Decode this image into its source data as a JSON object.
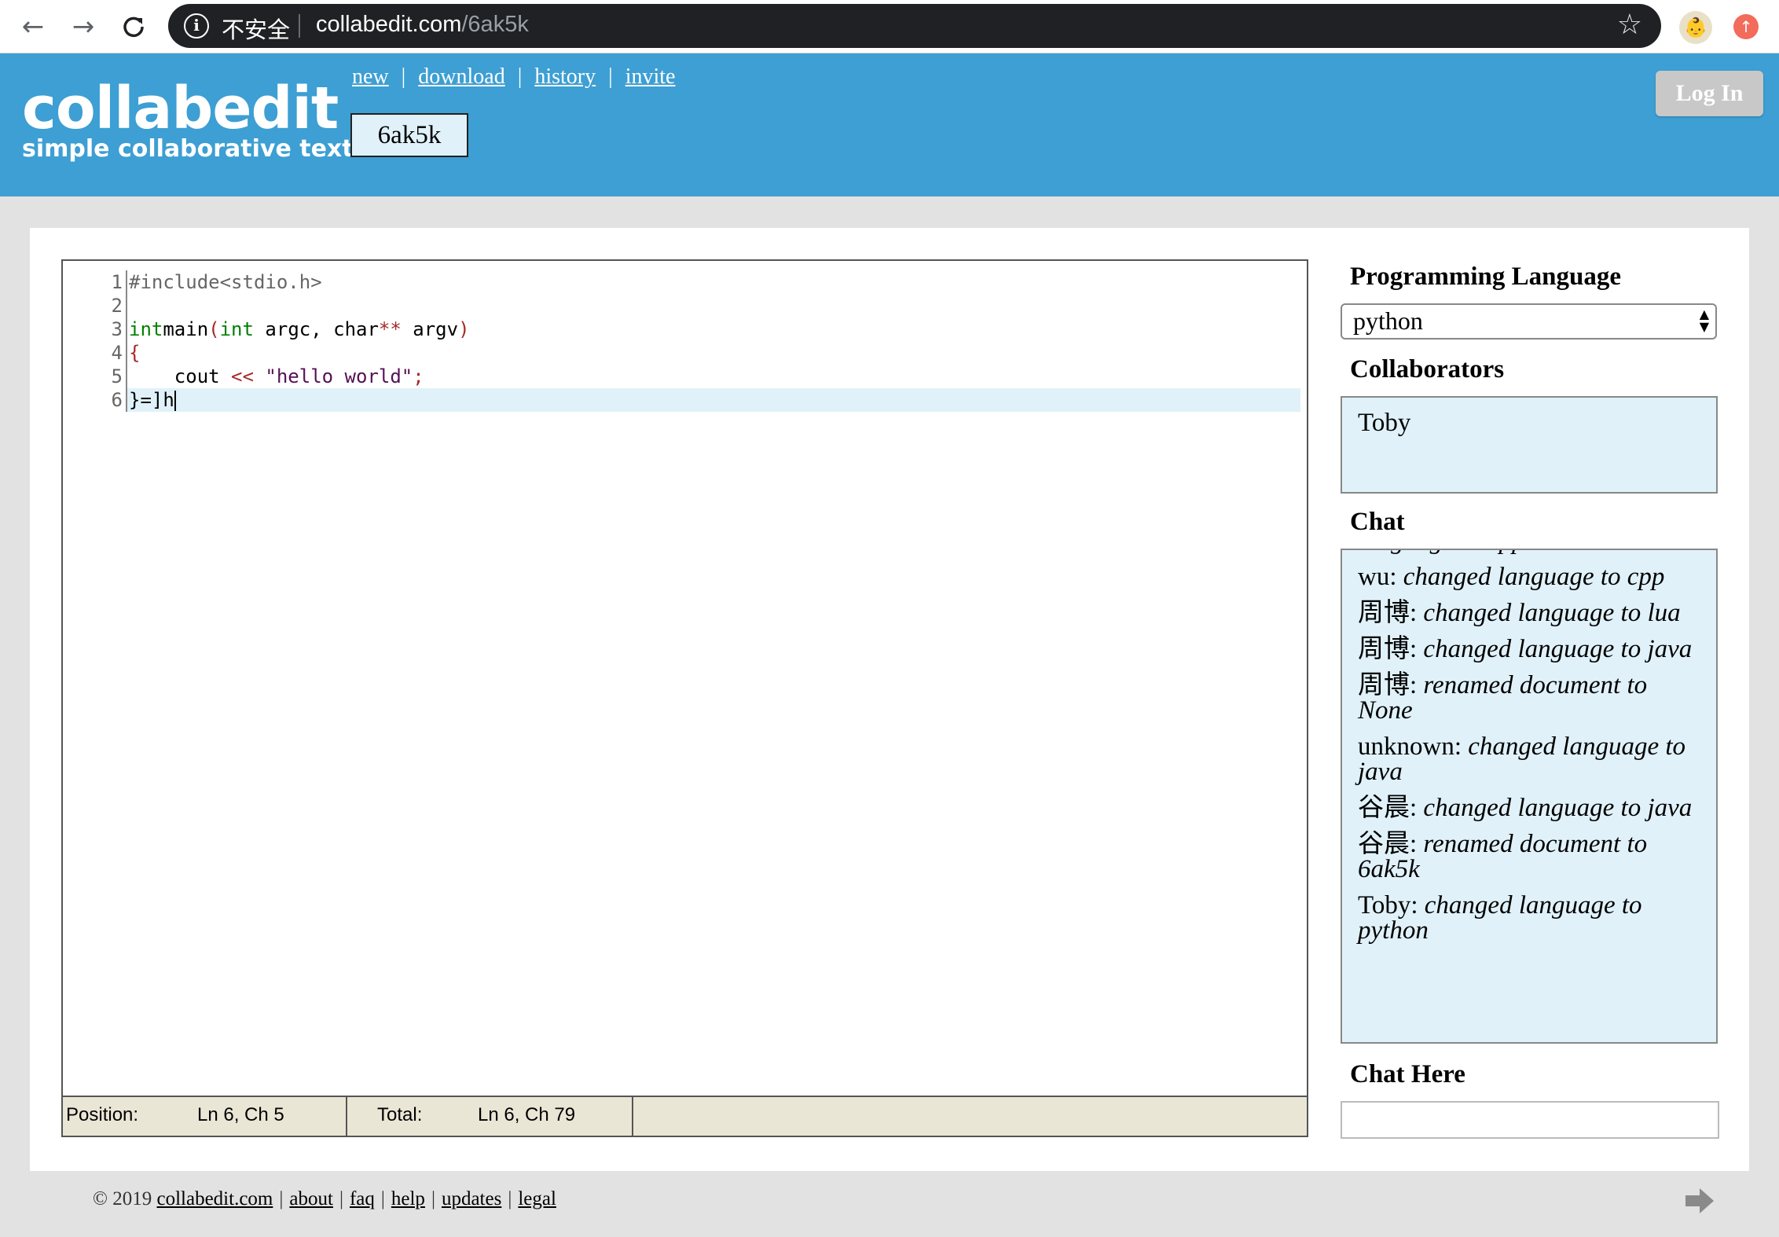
{
  "browser": {
    "security_label": "不安全",
    "url_host": "collabedit.com",
    "url_path": "/6ak5k"
  },
  "header": {
    "logo_title": "collabedit",
    "logo_tagline": "simple collaborative text",
    "nav": [
      "new",
      "download",
      "history",
      "invite"
    ],
    "doc_name": "6ak5k",
    "login_label": "Log In"
  },
  "editor": {
    "line_numbers": [
      "1",
      "2",
      "3",
      "4",
      "5",
      "6"
    ],
    "status": {
      "position_label": "Position:",
      "position_value": "Ln 6, Ch 5",
      "total_label": "Total:",
      "total_value": "Ln 6, Ch 79"
    }
  },
  "sidebar": {
    "language_title": "Programming Language",
    "language_value": "python",
    "collaborators_title": "Collaborators",
    "collaborators": [
      "Toby"
    ],
    "chat_title": "Chat",
    "chat": [
      {
        "user": "",
        "text": "language to cpp"
      },
      {
        "user": "wu: ",
        "text": "changed language to cpp"
      },
      {
        "user": "周博: ",
        "text": "changed language to lua"
      },
      {
        "user": "周博: ",
        "text": "changed language to java"
      },
      {
        "user": "周博: ",
        "text": "renamed document to None"
      },
      {
        "user": "unknown: ",
        "text": "changed language to java"
      },
      {
        "user": "谷晨: ",
        "text": "changed language to java"
      },
      {
        "user": "谷晨: ",
        "text": "renamed document to 6ak5k"
      },
      {
        "user": "Toby: ",
        "text": "changed language to python"
      }
    ],
    "chat_here_title": "Chat Here"
  },
  "footer": {
    "copyright": "© 2019 ",
    "links": [
      "collabedit.com",
      "about",
      "faq",
      "help",
      "updates",
      "legal"
    ]
  }
}
